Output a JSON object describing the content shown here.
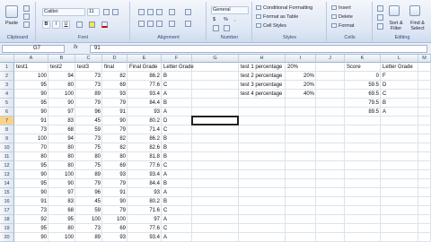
{
  "ribbon": {
    "clipboard": {
      "label": "Clipboard",
      "paste": "Paste"
    },
    "font": {
      "label": "Font",
      "name": "Calibri",
      "size": "11",
      "bold": "B",
      "italic": "I",
      "underline": "U"
    },
    "alignment": {
      "label": "Alignment"
    },
    "number": {
      "label": "Number",
      "format": "General",
      "currency": "$",
      "percent": "%",
      "comma": ","
    },
    "styles": {
      "label": "Styles",
      "conditional": "Conditional Formatting",
      "table": "Format as Table",
      "cell": "Cell Styles"
    },
    "cells": {
      "label": "Cells",
      "insert": "Insert",
      "delete": "Delete",
      "format": "Format"
    },
    "editing": {
      "label": "Editing",
      "sort": "Sort & Filter",
      "find": "Find & Select"
    }
  },
  "formula_bar": {
    "name_box": "G7",
    "fx": "fx",
    "value": "91"
  },
  "columns": [
    {
      "key": "A",
      "label": "A"
    },
    {
      "key": "B",
      "label": "B"
    },
    {
      "key": "C",
      "label": "C"
    },
    {
      "key": "D",
      "label": "D"
    },
    {
      "key": "E",
      "label": "E"
    },
    {
      "key": "F",
      "label": "F"
    },
    {
      "key": "G",
      "label": "G"
    },
    {
      "key": "H",
      "label": "H"
    },
    {
      "key": "I",
      "label": "I"
    },
    {
      "key": "J",
      "label": "J"
    },
    {
      "key": "K",
      "label": "K"
    },
    {
      "key": "L",
      "label": "L"
    },
    {
      "key": "M",
      "label": "M"
    }
  ],
  "rows": [
    {
      "n": "1",
      "cells": {
        "A": "test1",
        "B": "test2",
        "C": "test3",
        "D": "final",
        "E": "Final Grade",
        "F": "Letter Grade",
        "H": "test 1 percentage",
        "I": "20%",
        "K": "Score",
        "L": "Letter Grade"
      }
    },
    {
      "n": "2",
      "cells": {
        "A": "100",
        "B": "94",
        "C": "73",
        "D": "82",
        "E": "86.2",
        "F": "B",
        "H": "test 2 percentage",
        "I": "20%",
        "K": "0",
        "L": "F"
      }
    },
    {
      "n": "3",
      "cells": {
        "A": "95",
        "B": "80",
        "C": "73",
        "D": "69",
        "E": "77.6",
        "F": "C",
        "H": "test 3 percentage",
        "I": "20%",
        "K": "59.5",
        "L": "D"
      }
    },
    {
      "n": "4",
      "cells": {
        "A": "90",
        "B": "100",
        "C": "89",
        "D": "93",
        "E": "93.4",
        "F": "A",
        "H": "test 4 percentage",
        "I": "40%",
        "K": "69.5",
        "L": "C"
      }
    },
    {
      "n": "5",
      "cells": {
        "A": "95",
        "B": "90",
        "C": "79",
        "D": "79",
        "E": "84.4",
        "F": "B",
        "K": "79.5",
        "L": "B"
      }
    },
    {
      "n": "6",
      "cells": {
        "A": "90",
        "B": "97",
        "C": "96",
        "D": "91",
        "E": "93",
        "F": "A",
        "K": "89.5",
        "L": "A"
      }
    },
    {
      "n": "7",
      "cells": {
        "A": "91",
        "B": "83",
        "C": "45",
        "D": "90",
        "E": "80.2",
        "F": "D"
      }
    },
    {
      "n": "8",
      "cells": {
        "A": "73",
        "B": "68",
        "C": "59",
        "D": "79",
        "E": "71.4",
        "F": "C"
      }
    },
    {
      "n": "9",
      "cells": {
        "A": "100",
        "B": "94",
        "C": "73",
        "D": "82",
        "E": "86.2",
        "F": "B"
      }
    },
    {
      "n": "10",
      "cells": {
        "A": "70",
        "B": "80",
        "C": "75",
        "D": "82",
        "E": "82.6",
        "F": "B"
      }
    },
    {
      "n": "11",
      "cells": {
        "A": "80",
        "B": "80",
        "C": "80",
        "D": "80",
        "E": "81.8",
        "F": "B"
      }
    },
    {
      "n": "12",
      "cells": {
        "A": "95",
        "B": "80",
        "C": "75",
        "D": "69",
        "E": "77.6",
        "F": "C"
      }
    },
    {
      "n": "13",
      "cells": {
        "A": "90",
        "B": "100",
        "C": "89",
        "D": "93",
        "E": "93.4",
        "F": "A"
      }
    },
    {
      "n": "14",
      "cells": {
        "A": "95",
        "B": "90",
        "C": "79",
        "D": "79",
        "E": "84.4",
        "F": "B"
      }
    },
    {
      "n": "15",
      "cells": {
        "A": "90",
        "B": "97",
        "C": "96",
        "D": "91",
        "E": "93",
        "F": "A"
      }
    },
    {
      "n": "16",
      "cells": {
        "A": "91",
        "B": "83",
        "C": "45",
        "D": "90",
        "E": "80.2",
        "F": "B"
      }
    },
    {
      "n": "17",
      "cells": {
        "A": "73",
        "B": "68",
        "C": "59",
        "D": "79",
        "E": "71.6",
        "F": "C"
      }
    },
    {
      "n": "18",
      "cells": {
        "A": "92",
        "B": "95",
        "C": "100",
        "D": "100",
        "E": "97",
        "F": "A"
      }
    },
    {
      "n": "19",
      "cells": {
        "A": "95",
        "B": "80",
        "C": "73",
        "D": "69",
        "E": "77.6",
        "F": "C"
      }
    },
    {
      "n": "20",
      "cells": {
        "A": "90",
        "B": "100",
        "C": "89",
        "D": "93",
        "E": "93.4",
        "F": "A"
      }
    },
    {
      "n": "21",
      "cells": {
        "A": "95",
        "B": "90",
        "C": "79",
        "D": "79",
        "E": "84.4",
        "F": "B"
      }
    }
  ]
}
